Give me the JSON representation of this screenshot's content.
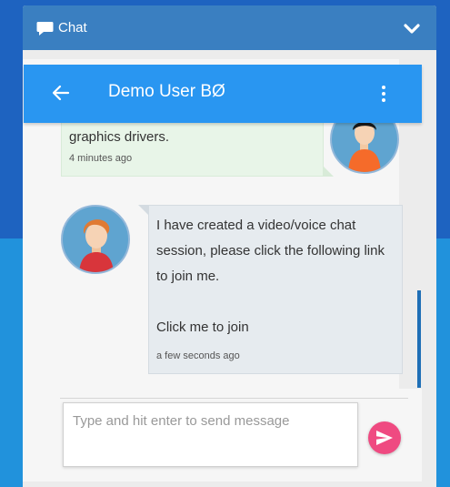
{
  "widget": {
    "title": "Chat",
    "icon": "speech-bubble-icon"
  },
  "topbar": {
    "contact_name": "Demo User BØ",
    "back_icon": "arrow-left-icon",
    "menu_icon": "more-vert-icon"
  },
  "messages": [
    {
      "direction": "outgoing",
      "text": "graphics drivers.",
      "time": "4 minutes ago"
    },
    {
      "direction": "incoming",
      "text": "I have created a video/voice chat session, please click the following link to join me.",
      "link_text": "Click me to join",
      "time": "a few seconds ago"
    }
  ],
  "composer": {
    "placeholder": "Type and hit enter to send message",
    "send_icon": "send-icon"
  },
  "colors": {
    "header": "#3a7fc1",
    "topbar": "#2996f1",
    "send": "#ef4a81",
    "outgoing_bubble": "#e8f5e8",
    "incoming_bubble": "#e6ebef"
  }
}
